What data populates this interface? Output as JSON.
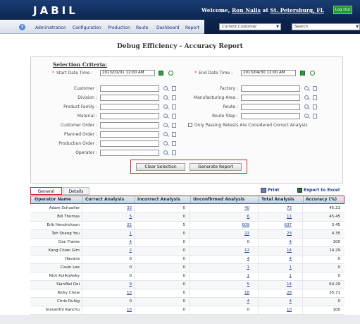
{
  "header": {
    "logo": "JABIL",
    "welcome_prefix": "Welcome,",
    "user": "Ron Nalls",
    "at": "at",
    "site": "St. Petersburg, FL",
    "logout": "Log Out"
  },
  "nav": {
    "items": [
      "Administration",
      "Configuration",
      "Production",
      "Route",
      "Dashboard",
      "Report"
    ],
    "customer_select": "Current Customer",
    "search_placeholder": "Search"
  },
  "page_title": "Debug Efficiency - Accuracy Report",
  "criteria": {
    "title": "Selection Criteria:",
    "start_label": "Start Date Time :",
    "start_value": "2013/01/01 12:00 AM",
    "end_label": "End Date Time :",
    "end_value": "2013/04/30 12:00 AM",
    "left_fields": [
      "Customer :",
      "Division :",
      "Product Family :",
      "Material :",
      "Customer Order :",
      "Planned Order :",
      "Production Order :",
      "Operator :"
    ],
    "right_fields": [
      "Factory :",
      "Manufacturing Area :",
      "Route :",
      "Route Step :"
    ],
    "checkbox_label": "Only Passing Retests Are Considered Correct Analysis",
    "clear_button": "Clear Selection",
    "generate_button": "Generate Report"
  },
  "tabs": [
    "General",
    "Details"
  ],
  "actions": {
    "print": "Print",
    "export": "Export to Excel"
  },
  "table": {
    "headers": [
      "Operator Name",
      "Correct Analysis",
      "Incorrect Analysis",
      "Unconfirmed Analysis",
      "Total Analysis",
      "Accuracy (%)"
    ],
    "rows": [
      [
        "Adam Schueller",
        "33",
        "0",
        "40",
        "73",
        "45.21"
      ],
      [
        "Bill Thomas",
        "5",
        "0",
        "6",
        "11",
        "45.45"
      ],
      [
        "Erik Hendrickson",
        "22",
        "5",
        "609",
        "637",
        "3.45"
      ],
      [
        "Teh Sheng You",
        "1",
        "0",
        "22",
        "23",
        "4.35"
      ],
      [
        "Dan Frame",
        "4",
        "0",
        "0",
        "4",
        "100"
      ],
      [
        "Kang Chian Gim",
        "2",
        "0",
        "12",
        "14",
        "14.29"
      ],
      [
        "Havana",
        "0",
        "0",
        "4",
        "4",
        "0"
      ],
      [
        "Cavin Lee",
        "0",
        "0",
        "1",
        "1",
        "0"
      ],
      [
        "Nick Kulikowsky",
        "0",
        "0",
        "1",
        "1",
        "0"
      ],
      [
        "SianWei Ooi",
        "9",
        "0",
        "5",
        "14",
        "64.29"
      ],
      [
        "Ricky Chow",
        "10",
        "0",
        "18",
        "28",
        "35.71"
      ],
      [
        "Chris Duhig",
        "0",
        "0",
        "4",
        "4",
        "0"
      ],
      [
        "Sravanthi Kanchu",
        "10",
        "0",
        "0",
        "10",
        "100"
      ]
    ]
  }
}
